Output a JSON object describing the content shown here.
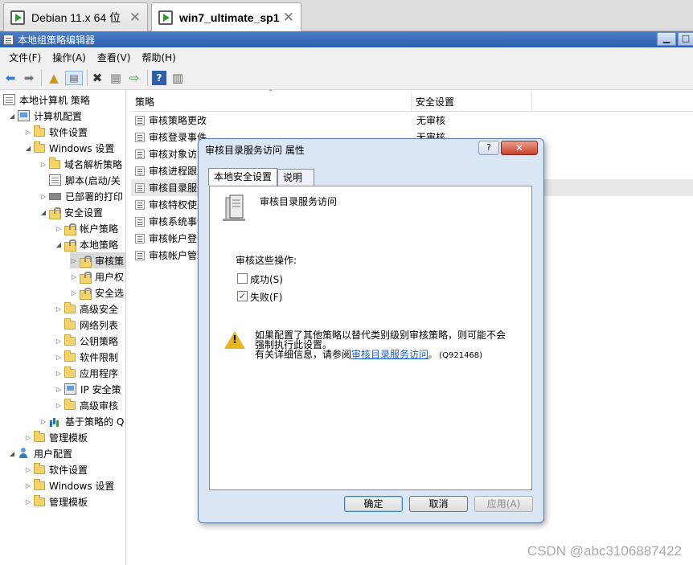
{
  "vm_tabs": [
    {
      "label": "Debian 11.x 64 位",
      "active": false
    },
    {
      "label": "win7_ultimate_sp1",
      "active": true
    }
  ],
  "window": {
    "title": "本地组策略编辑器",
    "minimize": "▁",
    "restore": "□"
  },
  "menu": [
    "文件(F)",
    "操作(A)",
    "查看(V)",
    "帮助(H)"
  ],
  "tree": [
    {
      "label": "本地计算机 策略",
      "icon": "policy-doc-icon"
    },
    {
      "label": "计算机配置",
      "icon": "computer-icon"
    },
    {
      "label": "软件设置",
      "icon": "folder-icon"
    },
    {
      "label": "Windows 设置",
      "icon": "folder-icon"
    },
    {
      "label": "域名解析策略",
      "icon": "folder-icon"
    },
    {
      "label": "脚本(启动/关",
      "icon": "script-icon"
    },
    {
      "label": "已部署的打印",
      "icon": "printer-icon"
    },
    {
      "label": "安全设置",
      "icon": "security-icon"
    },
    {
      "label": "帐户策略",
      "icon": "lock-folder-icon"
    },
    {
      "label": "本地策略",
      "icon": "lock-folder-icon"
    },
    {
      "label": "审核策",
      "icon": "lock-folder-icon"
    },
    {
      "label": "用户权",
      "icon": "lock-folder-icon"
    },
    {
      "label": "安全选",
      "icon": "lock-folder-icon"
    },
    {
      "label": "高级安全",
      "icon": "folder-icon"
    },
    {
      "label": "网络列表",
      "icon": "folder-icon"
    },
    {
      "label": "公钥策略",
      "icon": "folder-icon"
    },
    {
      "label": "软件限制",
      "icon": "folder-icon"
    },
    {
      "label": "应用程序",
      "icon": "folder-icon"
    },
    {
      "label": "IP 安全策",
      "icon": "ip-security-icon"
    },
    {
      "label": "高级审核",
      "icon": "folder-icon"
    },
    {
      "label": "基于策略的 Q",
      "icon": "chart-icon"
    },
    {
      "label": "管理模板",
      "icon": "folder-icon"
    },
    {
      "label": "用户配置",
      "icon": "user-icon"
    },
    {
      "label": "软件设置",
      "icon": "folder-icon"
    },
    {
      "label": "Windows 设置",
      "icon": "folder-icon"
    },
    {
      "label": "管理模板",
      "icon": "folder-icon"
    }
  ],
  "list": {
    "columns": [
      "策略",
      "安全设置"
    ],
    "rows": [
      {
        "name": "审核策略更改",
        "value": "无审核"
      },
      {
        "name": "审核登录事件",
        "value": "无审核"
      },
      {
        "name": "审核对象访问",
        "value": ""
      },
      {
        "name": "审核进程跟踪",
        "value": ""
      },
      {
        "name": "审核目录服务访问",
        "value": ""
      },
      {
        "name": "审核特权使用",
        "value": ""
      },
      {
        "name": "审核系统事件",
        "value": ""
      },
      {
        "name": "审核帐户登录事件",
        "value": ""
      },
      {
        "name": "审核帐户管理",
        "value": ""
      }
    ]
  },
  "dialog": {
    "title": "审核目录服务访问 属性",
    "help": "?",
    "close": "✕",
    "tabs": [
      "本地安全设置",
      "说明"
    ],
    "policy_name": "审核目录服务访问",
    "audit_label": "审核这些操作:",
    "success_label": "成功(S)",
    "success_checked": false,
    "failure_label": "失败(F)",
    "failure_checked": true,
    "check_mark": "✓",
    "warning_line1": "如果配置了其他策略以替代类别级别审核策略，则可能不会",
    "warning_line2": "强制执行此设置。",
    "warning_more_prefix": "有关详细信息，请参阅",
    "warning_link": "审核目录服务访问",
    "warning_suffix": "。 (Q921468)",
    "buttons": {
      "ok": "确定",
      "cancel": "取消",
      "apply": "应用(A)"
    }
  },
  "watermark": "CSDN @abc3106887422"
}
